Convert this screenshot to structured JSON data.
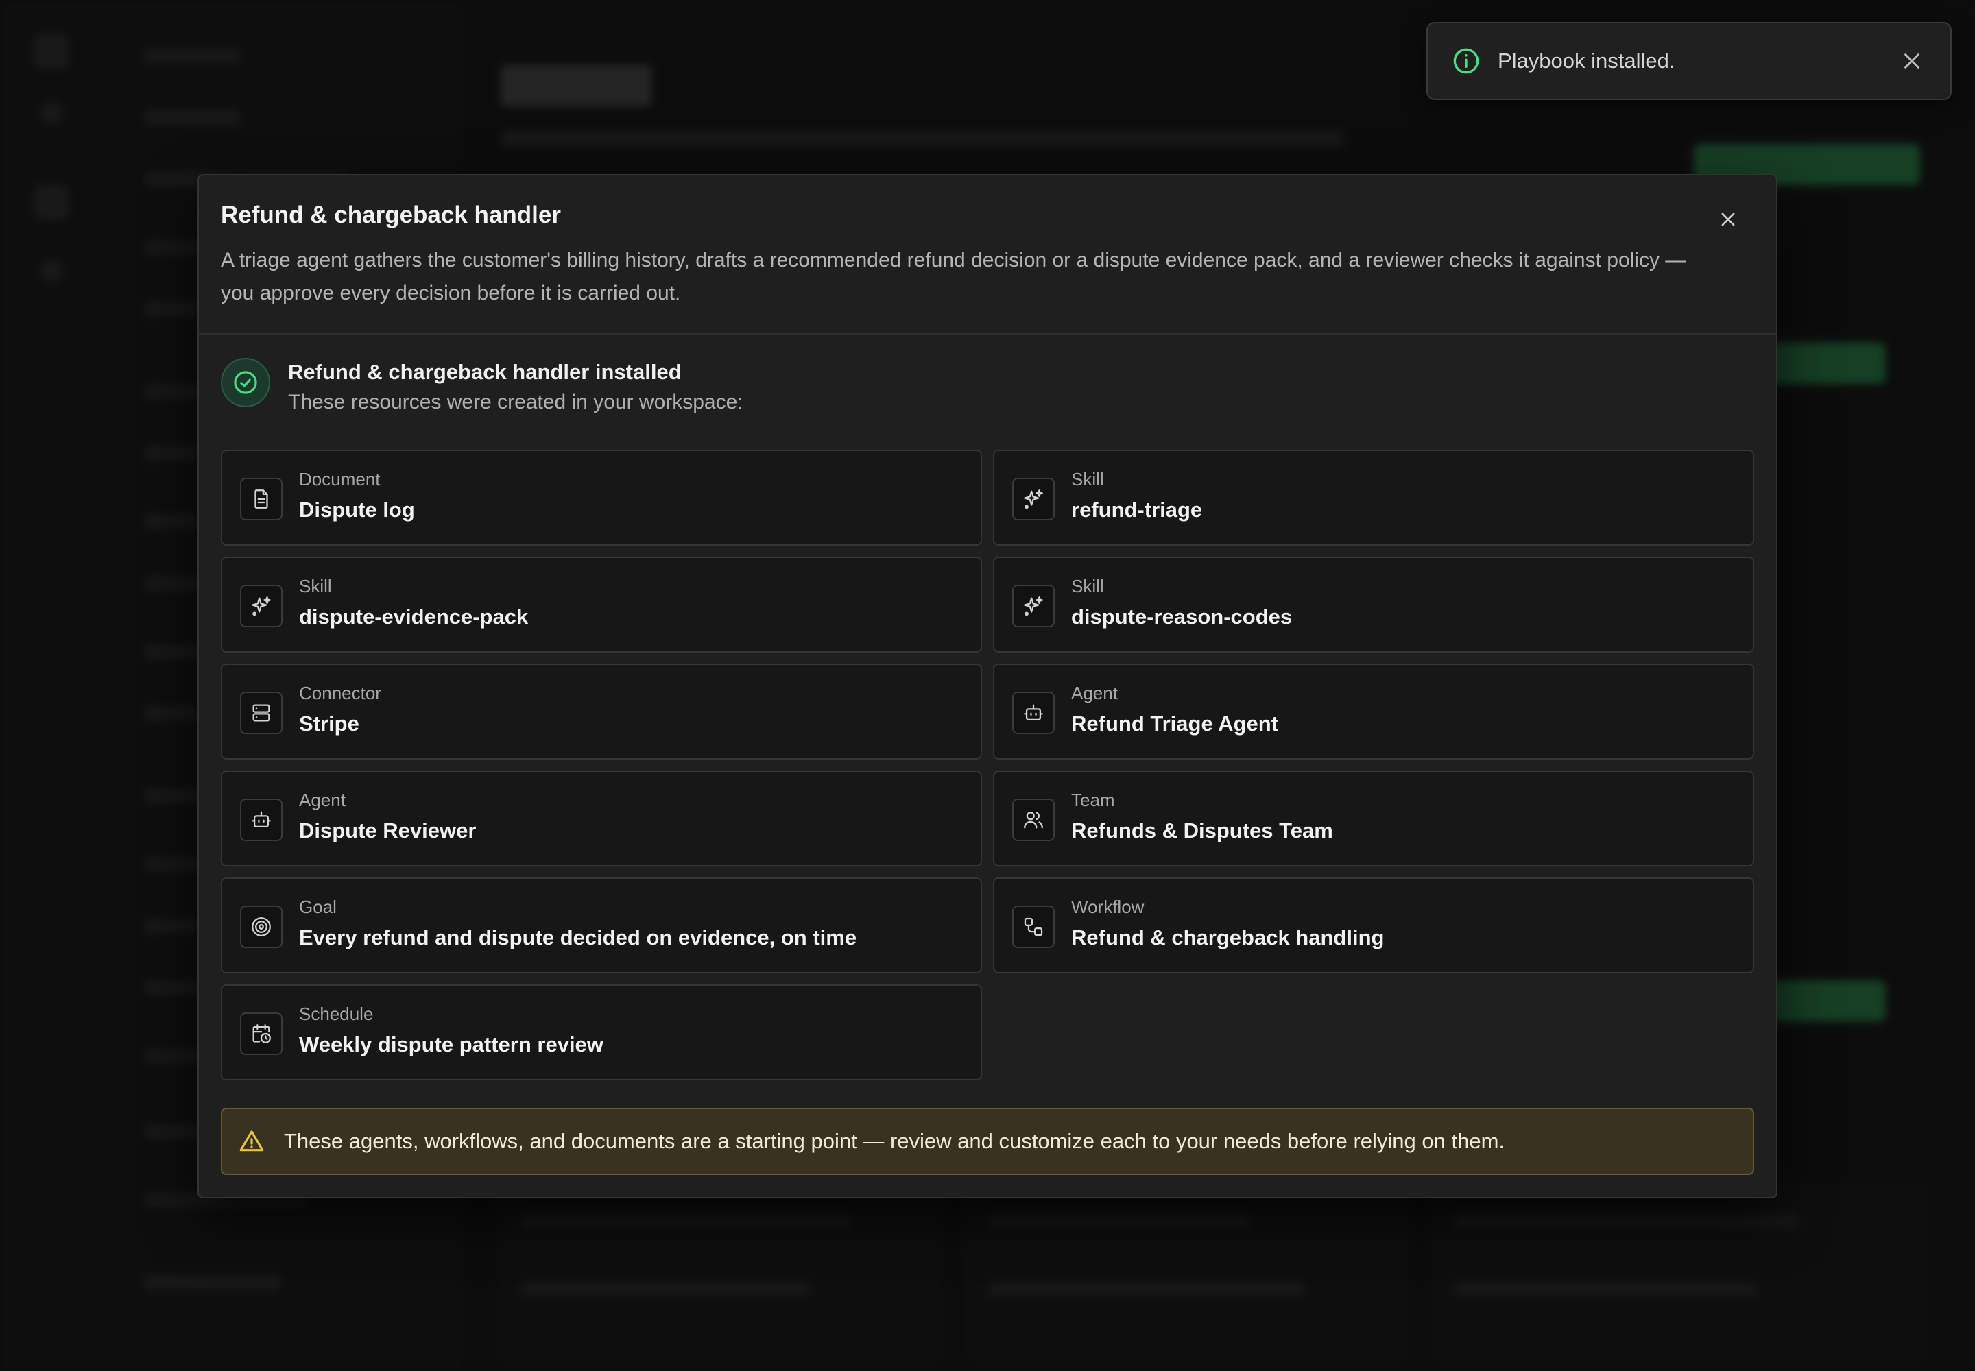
{
  "toast": {
    "message": "Playbook installed."
  },
  "modal": {
    "title": "Refund & chargeback handler",
    "description": "A triage agent gathers the customer's billing history, drafts a recommended refund decision or a dispute evidence pack, and a reviewer checks it against policy — you approve every decision before it is carried out.",
    "installed_title": "Refund & chargeback handler installed",
    "installed_subtitle": "These resources were created in your workspace:",
    "resources": [
      {
        "type": "Document",
        "name": "Dispute log",
        "icon": "document-icon"
      },
      {
        "type": "Skill",
        "name": "refund-triage",
        "icon": "sparkle-icon"
      },
      {
        "type": "Skill",
        "name": "dispute-evidence-pack",
        "icon": "sparkle-icon"
      },
      {
        "type": "Skill",
        "name": "dispute-reason-codes",
        "icon": "sparkle-icon"
      },
      {
        "type": "Connector",
        "name": "Stripe",
        "icon": "server-icon"
      },
      {
        "type": "Agent",
        "name": "Refund Triage Agent",
        "icon": "robot-icon"
      },
      {
        "type": "Agent",
        "name": "Dispute Reviewer",
        "icon": "robot-icon"
      },
      {
        "type": "Team",
        "name": "Refunds & Disputes Team",
        "icon": "users-icon"
      },
      {
        "type": "Goal",
        "name": "Every refund and dispute decided on evidence, on time",
        "icon": "target-icon"
      },
      {
        "type": "Workflow",
        "name": "Refund & chargeback handling",
        "icon": "workflow-icon"
      },
      {
        "type": "Schedule",
        "name": "Weekly dispute pattern review",
        "icon": "calendar-clock-icon"
      }
    ],
    "warning": "These agents, workflows, and documents are a starting point — review and customize each to your needs before relying on them."
  },
  "colors": {
    "accent_green": "#4ade80",
    "warning_yellow": "#e6c24a"
  }
}
